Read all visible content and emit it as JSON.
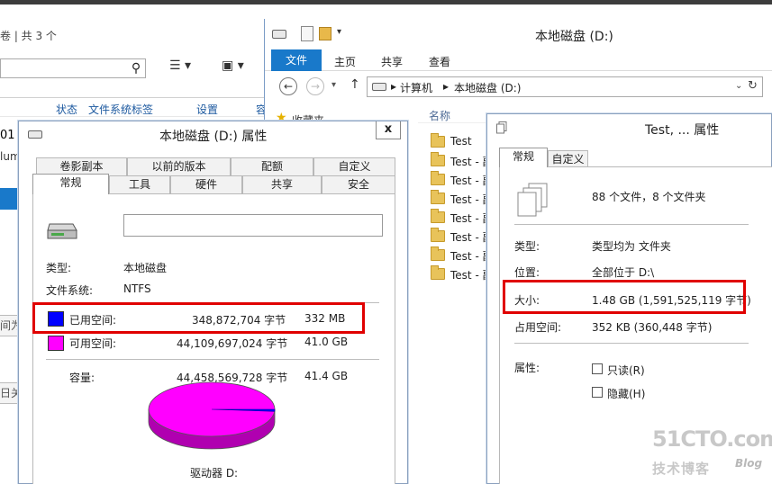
{
  "background_window": {
    "crumb": "卷 | 共 3 个",
    "columns": [
      "状态",
      "文件系统标签",
      "设置"
    ],
    "col_partial": "容",
    "line1": "01 (",
    "line2": "lum",
    "box1": "间为",
    "box2": "日关"
  },
  "explorer": {
    "title": "本地磁盘 (D:)",
    "tabs": {
      "file": "文件",
      "home": "主页",
      "share": "共享",
      "view": "查看"
    },
    "address": {
      "computer": "计算机",
      "drive": "本地磁盘 (D:)",
      "sep": "▸"
    },
    "favorites": "收藏夹",
    "column_name": "名称",
    "files": [
      "Test",
      "Test - 副",
      "Test - 副",
      "Test - 副",
      "Test - 副",
      "Test - 副",
      "Test - 副",
      "Test - 副"
    ]
  },
  "drive_properties": {
    "title": "本地磁盘 (D:) 属性",
    "close": "x",
    "tabs_row1": [
      "卷影副本",
      "以前的版本",
      "配额",
      "自定义"
    ],
    "tabs_row2": [
      "常规",
      "工具",
      "硬件",
      "共享",
      "安全"
    ],
    "name_value": "",
    "type_label": "类型:",
    "type_value": "本地磁盘",
    "fs_label": "文件系统:",
    "fs_value": "NTFS",
    "used_label": "已用空间:",
    "used_bytes": "348,872,704 字节",
    "used_size": "332 MB",
    "free_label": "可用空间:",
    "free_bytes": "44,109,697,024 字节",
    "free_size": "41.0 GB",
    "capacity_label": "容量:",
    "capacity_bytes": "44,458,569,728 字节",
    "capacity_size": "41.4 GB",
    "drive_label": "驱动器 D:",
    "used_fraction": 0.0078,
    "colors": {
      "used": "#0000ff",
      "free": "#ff00ff"
    }
  },
  "folder_properties": {
    "title": "Test, ... 属性",
    "tabs": [
      "常规",
      "自定义"
    ],
    "count": "88 个文件，8 个文件夹",
    "type_label": "类型:",
    "type_value": "类型均为 文件夹",
    "location_label": "位置:",
    "location_value": "全部位于 D:\\",
    "size_label": "大小:",
    "size_value": "1.48 GB (1,591,525,119 字节)",
    "disk_label": "占用空间:",
    "disk_value": "352 KB (360,448 字节)",
    "attr_label": "属性:",
    "readonly": "只读(R)",
    "hidden": "隐藏(H)"
  },
  "watermark": {
    "site": "51CTO.com",
    "sub": "技术博客",
    "blog": "Blog"
  }
}
